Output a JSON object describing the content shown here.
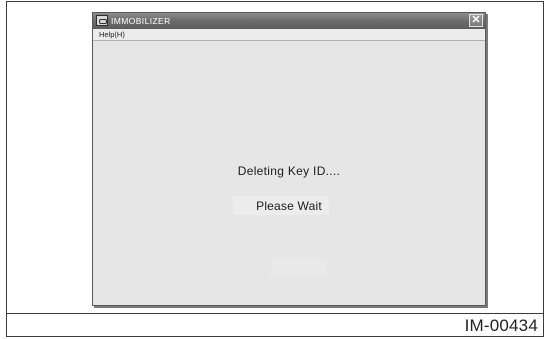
{
  "window": {
    "title": "IMMOBILIZER",
    "close_glyph": "✕",
    "app_icon": "immobilizer-app-icon"
  },
  "menu": {
    "help_label": "Help(H)"
  },
  "content": {
    "status_message": "Deleting Key ID....",
    "wait_message": "Please Wait"
  },
  "figure": {
    "id": "IM-00434"
  }
}
